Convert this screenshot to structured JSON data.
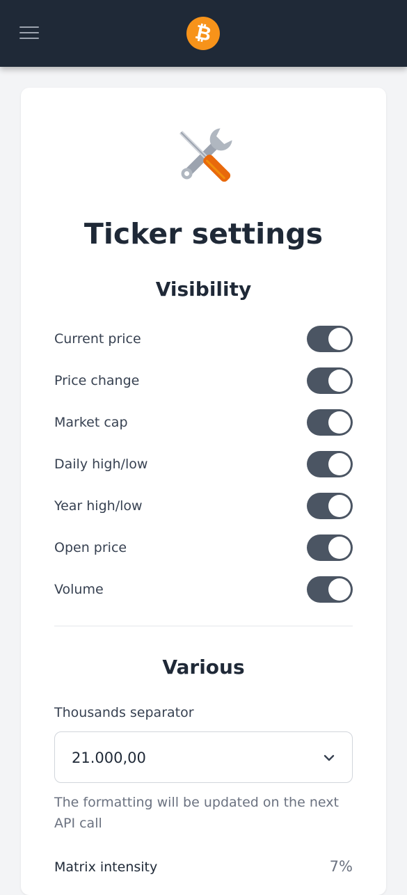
{
  "header": {
    "menu_icon": "hamburger-menu-icon",
    "logo_icon": "bitcoin-logo-icon",
    "colors": {
      "bar": "#1f2937",
      "logo": "#f7931a"
    }
  },
  "settings": {
    "icon": "wrench-screwdriver-icon",
    "title": "Ticker settings",
    "visibility": {
      "heading": "Visibility",
      "items": [
        {
          "label": "Current price",
          "enabled": true
        },
        {
          "label": "Price change",
          "enabled": true
        },
        {
          "label": "Market cap",
          "enabled": true
        },
        {
          "label": "Daily high/low",
          "enabled": true
        },
        {
          "label": "Year high/low",
          "enabled": true
        },
        {
          "label": "Open price",
          "enabled": true
        },
        {
          "label": "Volume",
          "enabled": true
        }
      ]
    },
    "various": {
      "heading": "Various",
      "thousands_separator": {
        "label": "Thousands separator",
        "value": "21.000,00",
        "help": "The formatting will be updated on the next API call"
      },
      "matrix_intensity": {
        "label": "Matrix intensity",
        "value": "7%"
      }
    }
  }
}
